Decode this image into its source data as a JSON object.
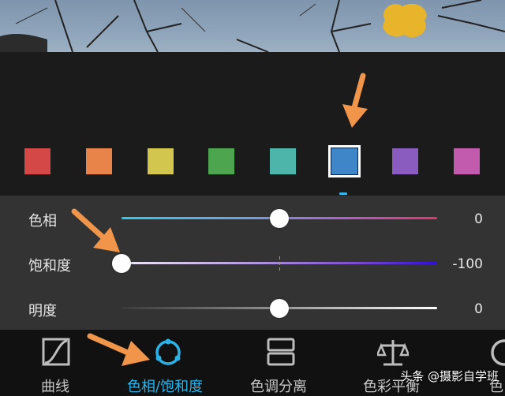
{
  "swatches": [
    {
      "name": "red",
      "color": "#d44848"
    },
    {
      "name": "orange",
      "color": "#e8834a"
    },
    {
      "name": "yellow",
      "color": "#d3c64e"
    },
    {
      "name": "green",
      "color": "#4da64f"
    },
    {
      "name": "aqua",
      "color": "#4db5a9"
    },
    {
      "name": "blue",
      "color": "#3f86c8",
      "selected": true
    },
    {
      "name": "purple",
      "color": "#8a5cbf"
    },
    {
      "name": "magenta",
      "color": "#c25aae"
    }
  ],
  "sliders": {
    "hue": {
      "label": "色相",
      "value": "0",
      "level": 0.5
    },
    "saturation": {
      "label": "饱和度",
      "value": "-100",
      "level": 0.0
    },
    "lightness": {
      "label": "明度",
      "value": "0",
      "level": 0.5
    }
  },
  "tabs": [
    {
      "label": "曲线",
      "icon": "curve-icon"
    },
    {
      "label": "色相/饱和度",
      "icon": "hsl-ring-icon",
      "active": true
    },
    {
      "label": "色调分离",
      "icon": "split-tone-icon"
    },
    {
      "label": "色彩平衡",
      "icon": "balance-scale-icon"
    },
    {
      "label": "色",
      "icon": "partial-icon"
    }
  ],
  "watermark": "头条 @摄影自学班",
  "colors": {
    "accent": "#2bb3e8",
    "arrow": "#f0954a"
  }
}
